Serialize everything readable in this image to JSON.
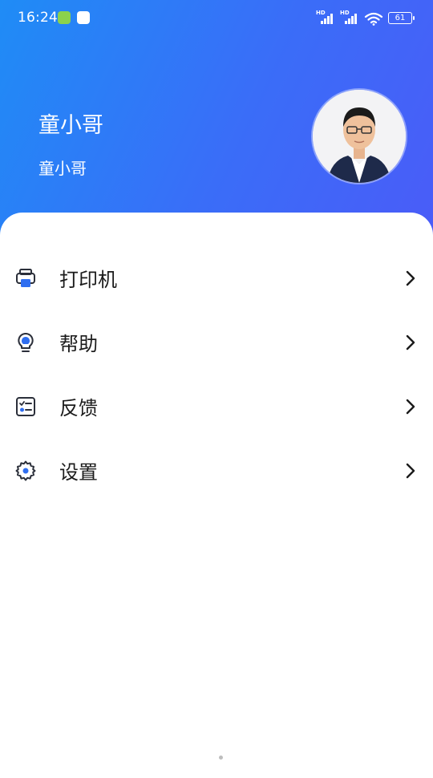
{
  "status_bar": {
    "time": "16:24",
    "battery": "61",
    "signal_badge": "HD"
  },
  "profile": {
    "name": "童小哥",
    "subtitle": "童小哥"
  },
  "menu": {
    "items": [
      {
        "label": "打印机",
        "icon": "printer-icon"
      },
      {
        "label": "帮助",
        "icon": "lightbulb-icon"
      },
      {
        "label": "反馈",
        "icon": "feedback-icon"
      },
      {
        "label": "设置",
        "icon": "gear-icon"
      }
    ]
  },
  "colors": {
    "header_gradient_start": "#1f8cf6",
    "header_gradient_end": "#4a5cf8",
    "icon_accent": "#2f6ef0",
    "icon_stroke": "#2b2f3a"
  }
}
